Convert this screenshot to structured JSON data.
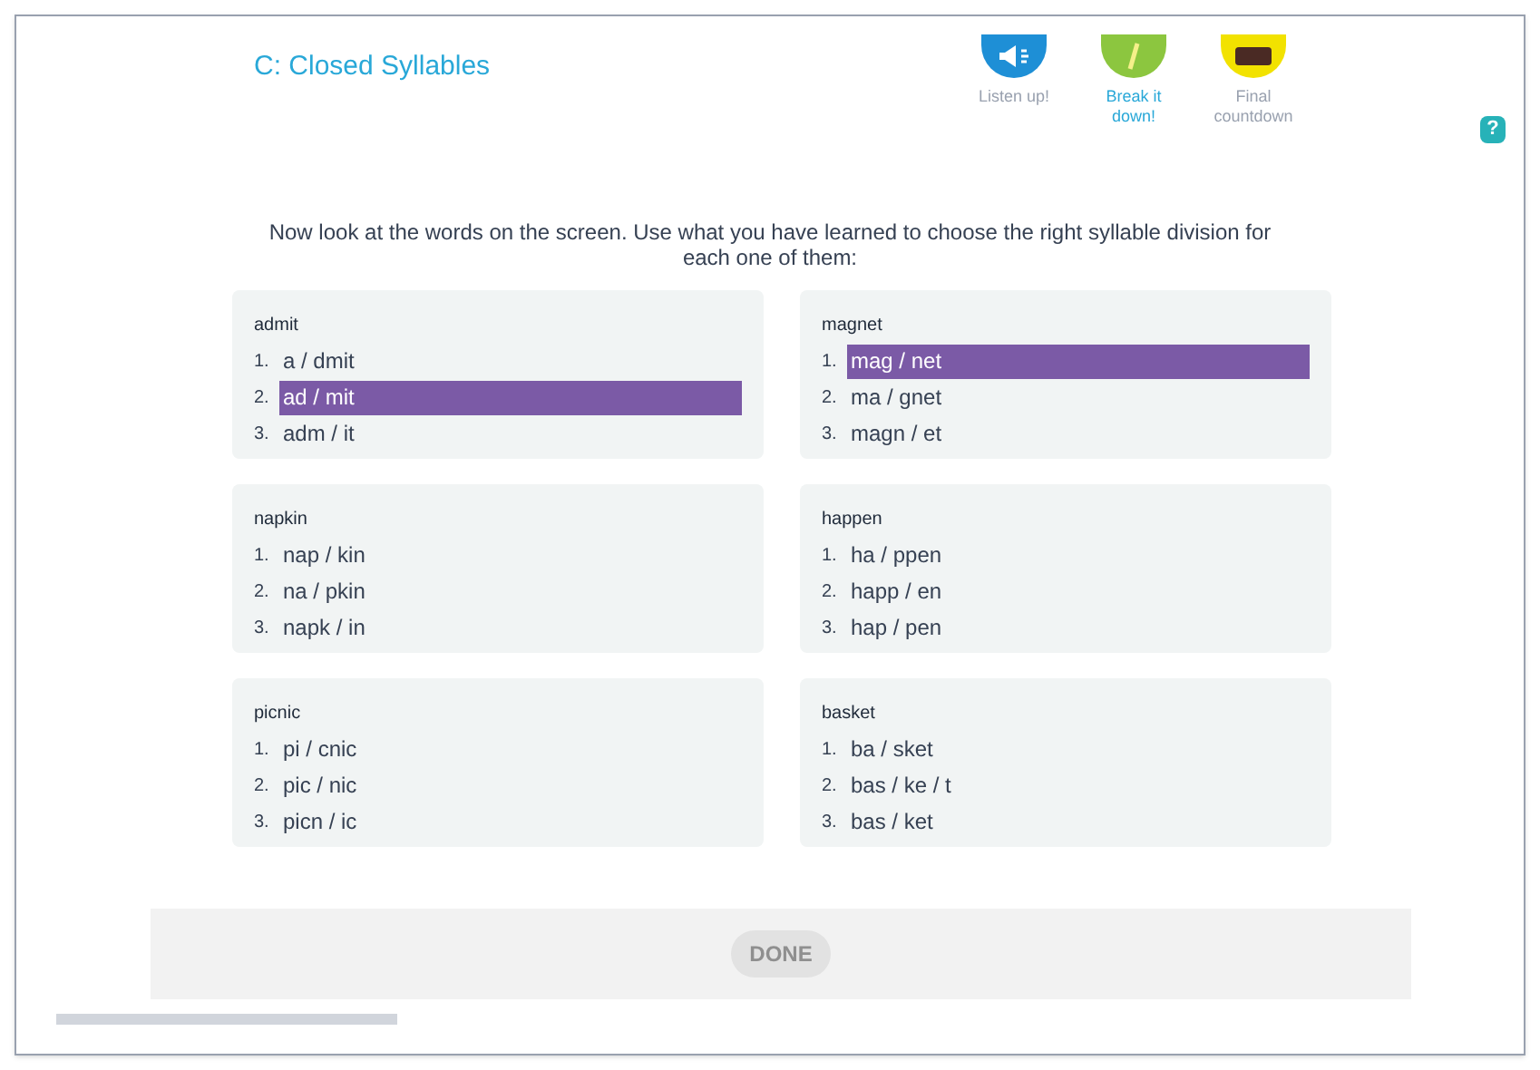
{
  "title": "C: Closed Syllables",
  "steps": [
    {
      "label": "Listen up!",
      "selected": false,
      "color": "#1e8fd6"
    },
    {
      "label": "Break it down!",
      "selected": true,
      "color": "#8cc63f"
    },
    {
      "label": "Final countdown",
      "selected": false,
      "color": "#f2e200"
    }
  ],
  "instruction": "Now look at the words on the screen. Use what you have learned to choose the right syllable division for each one of them:",
  "questions": [
    {
      "word": "admit",
      "options": [
        {
          "number": "1.",
          "text": "a / dmit",
          "selected": false
        },
        {
          "number": "2.",
          "text": "ad / mit",
          "selected": true
        },
        {
          "number": "3.",
          "text": "adm / it",
          "selected": false
        }
      ]
    },
    {
      "word": "magnet",
      "options": [
        {
          "number": "1.",
          "text": "mag / net",
          "selected": true
        },
        {
          "number": "2.",
          "text": "ma / gnet",
          "selected": false
        },
        {
          "number": "3.",
          "text": "magn / et",
          "selected": false
        }
      ]
    },
    {
      "word": "napkin",
      "options": [
        {
          "number": "1.",
          "text": "nap / kin",
          "selected": false
        },
        {
          "number": "2.",
          "text": "na / pkin",
          "selected": false
        },
        {
          "number": "3.",
          "text": "napk / in",
          "selected": false
        }
      ]
    },
    {
      "word": "happen",
      "options": [
        {
          "number": "1.",
          "text": "ha / ppen",
          "selected": false
        },
        {
          "number": "2.",
          "text": "happ / en",
          "selected": false
        },
        {
          "number": "3.",
          "text": "hap / pen",
          "selected": false
        }
      ]
    },
    {
      "word": "picnic",
      "options": [
        {
          "number": "1.",
          "text": "pi / cnic",
          "selected": false
        },
        {
          "number": "2.",
          "text": "pic / nic",
          "selected": false
        },
        {
          "number": "3.",
          "text": "picn / ic",
          "selected": false
        }
      ]
    },
    {
      "word": "basket",
      "options": [
        {
          "number": "1.",
          "text": "ba / sket",
          "selected": false
        },
        {
          "number": "2.",
          "text": "bas / ke / t",
          "selected": false
        },
        {
          "number": "3.",
          "text": "bas / ket",
          "selected": false
        }
      ]
    }
  ],
  "done_button": {
    "label": "DONE",
    "disabled": true
  },
  "help_button": {
    "label": "?"
  }
}
